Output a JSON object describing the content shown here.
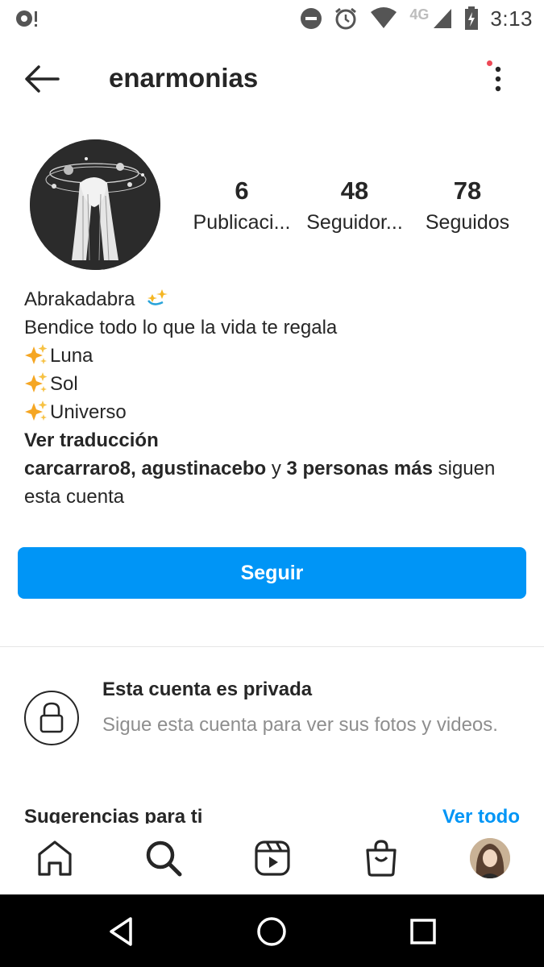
{
  "status_bar": {
    "time": "3:13",
    "network": "4G",
    "icons": [
      "dnd-icon",
      "alarm-icon",
      "wifi-icon",
      "cell-signal-icon",
      "battery-charging-icon"
    ]
  },
  "header": {
    "username": "enarmonias"
  },
  "profile": {
    "stats": [
      {
        "value": "6",
        "label": "Publicaci..."
      },
      {
        "value": "48",
        "label": "Seguidor..."
      },
      {
        "value": "78",
        "label": "Seguidos"
      }
    ],
    "bio": {
      "name": "Abrakadabra",
      "line1": "Bendice todo lo que la vida te regala",
      "items": [
        "Luna",
        "Sol",
        "Universo"
      ],
      "translate": "Ver traducción",
      "followers_user1": "carcarraro8,",
      "followers_user2": "agustinacebo",
      "followers_and": " y ",
      "followers_more": "3 personas más",
      "followers_suffix": " siguen esta cuenta"
    }
  },
  "follow_button": {
    "label": "Seguir"
  },
  "private_notice": {
    "title": "Esta cuenta es privada",
    "description": "Sigue esta cuenta para ver sus fotos y videos."
  },
  "suggestions": {
    "title": "Sugerencias para ti",
    "see_all": "Ver todo"
  },
  "colors": {
    "accent": "#0095f6",
    "text": "#262626",
    "secondary_text": "#8e8e8e",
    "notification": "#ed4956"
  }
}
